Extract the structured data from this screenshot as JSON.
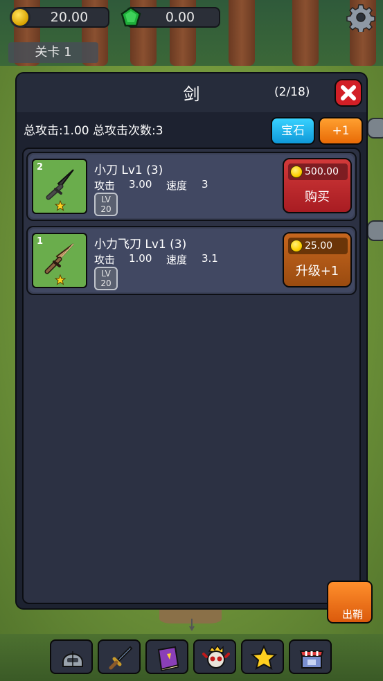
{
  "hud": {
    "gold": "20.00",
    "gems": "0.00",
    "stage": "关卡 1"
  },
  "dialog": {
    "title": "剑",
    "count": "(2/18)",
    "stats": "总攻击:1.00 总攻击次数:3",
    "gem_button": "宝石",
    "plus_button": "+1"
  },
  "weapons": [
    {
      "index": "2",
      "name": "小刀 Lv1 (3)",
      "attack_label": "攻击",
      "attack": "3.00",
      "speed_label": "速度",
      "speed": "3",
      "lv_badge": "LV",
      "lv_value": "20",
      "price": "500.00",
      "action": "购买"
    },
    {
      "index": "1",
      "name": "小力飞刀 Lv1 (3)",
      "attack_label": "攻击",
      "attack": "1.00",
      "speed_label": "速度",
      "speed": "3.1",
      "lv_badge": "LV",
      "lv_value": "20",
      "price": "25.00",
      "action": "升级+1"
    }
  ],
  "side_button": "出鞘",
  "nav": [
    "helmet-icon",
    "sword-icon",
    "spellbook-icon",
    "skull-icon",
    "star-icon",
    "shop-icon"
  ],
  "colors": {
    "buy_red": "#c42a2f",
    "upgrade_orange": "#b65a18",
    "gem_blue": "#1fb3ee",
    "plus_orange": "#f5820f",
    "close_red": "#d21f26"
  }
}
